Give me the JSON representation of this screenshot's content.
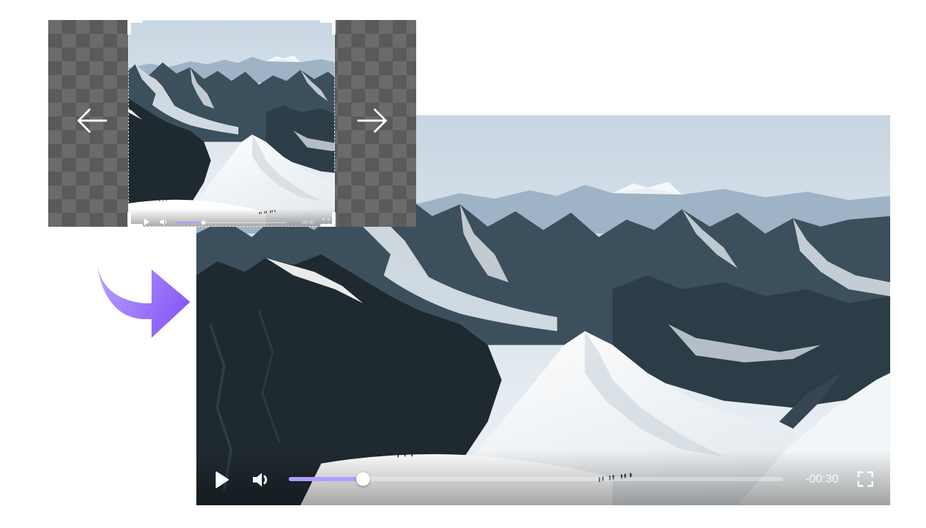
{
  "editor": {
    "crop_preview": {
      "pan_left_icon": "arrow-left-icon",
      "pan_right_icon": "arrow-right-icon",
      "player": {
        "time_remaining": "-00:30",
        "progress": 0.25
      }
    },
    "transition_icon": "curved-arrow-right-icon",
    "player": {
      "time_remaining": "-00:30",
      "progress": 0.15,
      "icons": {
        "play": "play-icon",
        "volume": "volume-icon",
        "fullscreen": "fullscreen-icon"
      }
    }
  },
  "colors": {
    "accent": "#b39dfc",
    "arrow_gradient_start": "#b9a6ff",
    "arrow_gradient_end": "#8a5cf6",
    "checker_light": "#6b6b6b",
    "checker_dark": "#5a5a5a"
  }
}
